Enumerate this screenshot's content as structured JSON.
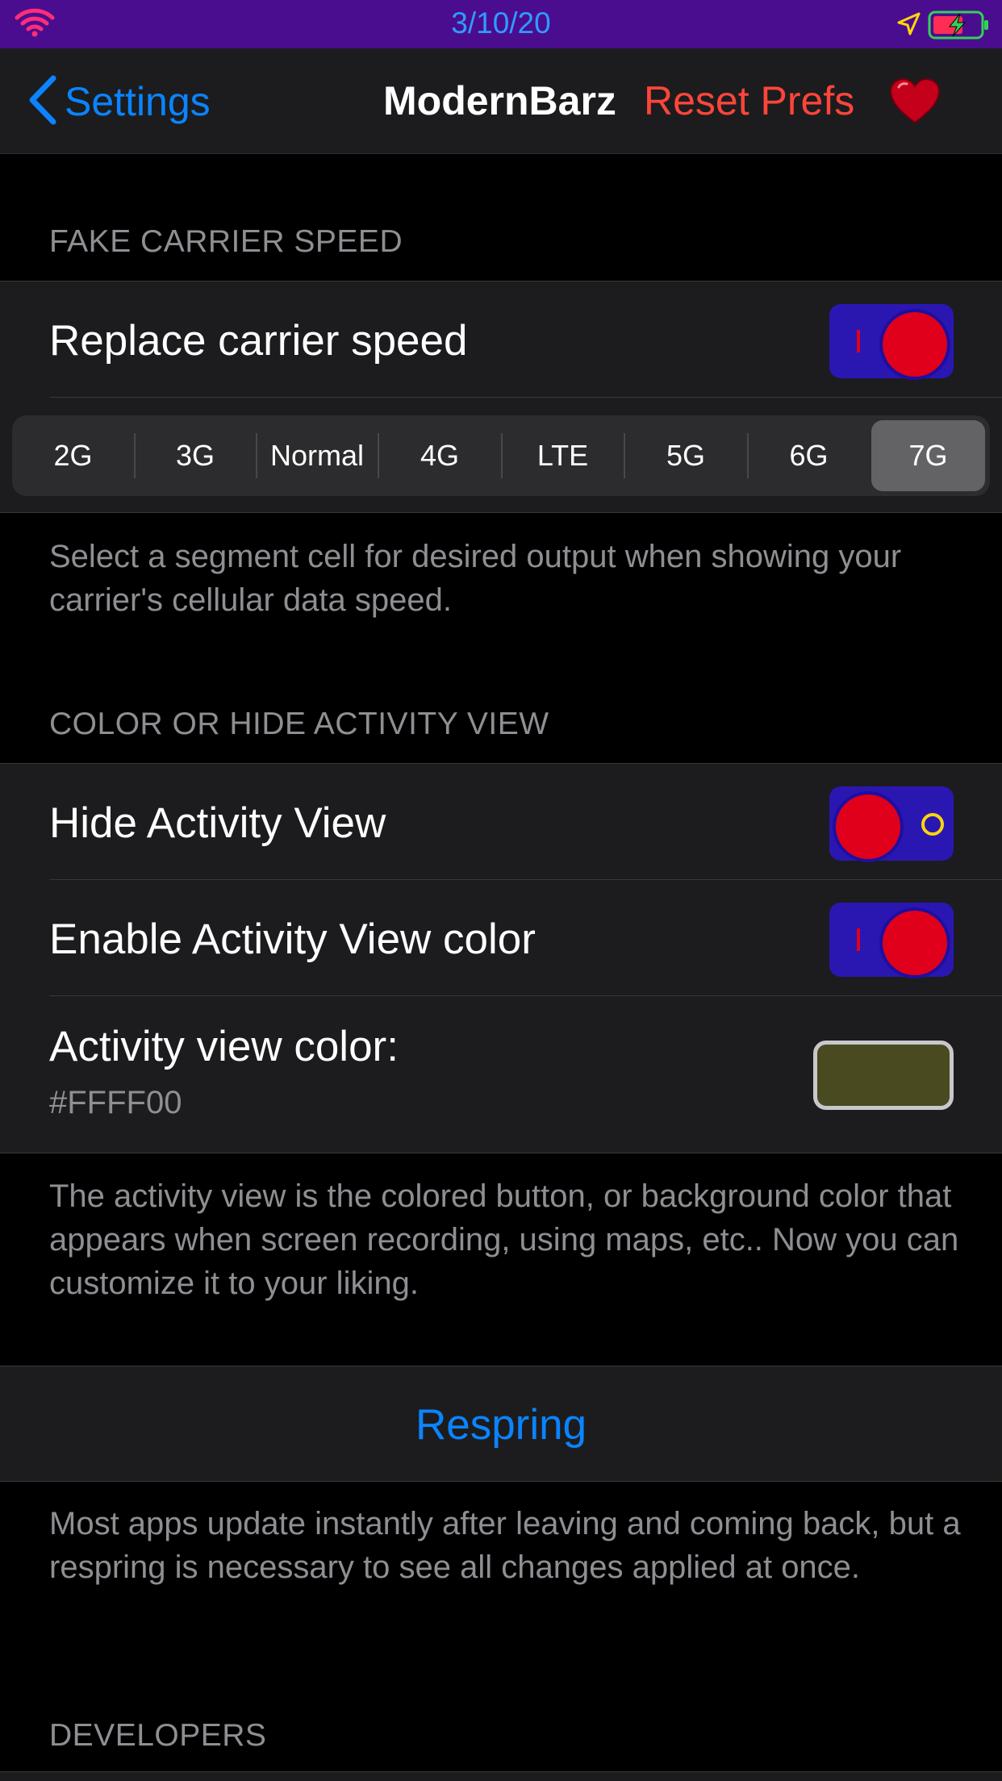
{
  "status_bar": {
    "date": "3/10/20",
    "colors": {
      "background": "#4b0d8f",
      "date": "#2f9cff",
      "wifi": "#ff2d78",
      "battery": "#31d158"
    }
  },
  "nav": {
    "back_label": "Settings",
    "title": "ModernBarz",
    "reset_label": "Reset Prefs",
    "icons": [
      "chevron-left-icon",
      "heart-icon"
    ]
  },
  "carrier_section": {
    "header": "FAKE CARRIER SPEED",
    "replace_label": "Replace carrier speed",
    "replace_on": true,
    "segments": [
      "2G",
      "3G",
      "Normal",
      "4G",
      "LTE",
      "5G",
      "6G",
      "7G"
    ],
    "selected_segment": "7G",
    "footer": "Select a segment cell for desired output when showing your carrier's cellular data speed."
  },
  "activity_section": {
    "header": "COLOR OR HIDE ACTIVITY VIEW",
    "hide_label": "Hide Activity View",
    "hide_on": false,
    "enable_color_label": "Enable Activity View color",
    "enable_color_on": true,
    "color_label": "Activity view color:",
    "color_value": "#FFFF00",
    "footer": "The activity view is the colored button, or background color that appears when screen recording, using maps, etc.. Now you can customize it to your liking."
  },
  "respring": {
    "label": "Respring",
    "footer": "Most apps update instantly after leaving and coming back, but a respring is necessary to see all changes applied at once."
  },
  "developers_section": {
    "header": "DEVELOPERS"
  },
  "theme": {
    "toggle_track": "#2a17b2",
    "toggle_knob": "#e0001b",
    "link_blue": "#0a84ff",
    "destructive_red": "#ff453a"
  }
}
